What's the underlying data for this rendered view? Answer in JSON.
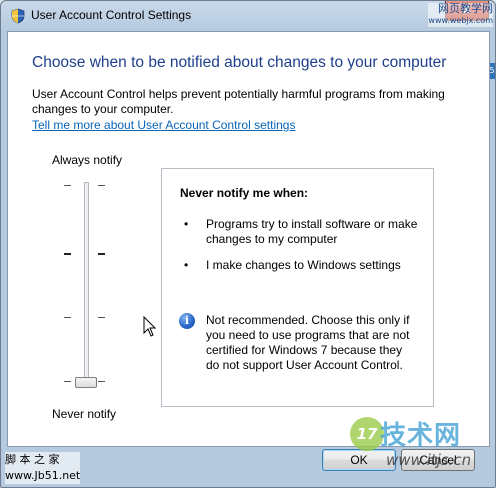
{
  "window": {
    "title": "User Account Control Settings",
    "close_label": "x"
  },
  "watermark_top_right": {
    "line1": "网页教学网",
    "line2": "www.webjx.com"
  },
  "main": {
    "heading": "Choose when to be notified about changes to your computer",
    "description": "User Account Control helps prevent potentially harmful programs from making changes to your computer.",
    "link": "Tell me more about User Account Control settings"
  },
  "slider": {
    "top_label": "Always notify",
    "bottom_label": "Never notify",
    "levels": 4,
    "selected_level": 1
  },
  "info": {
    "title": "Never notify me when:",
    "bullets": [
      "Programs try to install software or make changes to my computer",
      "I make changes to Windows settings"
    ],
    "note": "Not recommended. Choose this only if you need to use programs that are not certified for Windows 7 because they do not support User Account Control."
  },
  "buttons": {
    "ok": "OK",
    "cancel": "Cancel"
  },
  "watermark_bottom_left": {
    "line1": "脚 本 之 家",
    "line2": "www.Jb51.net"
  },
  "watermark_bottom_right": {
    "brand": "技术网",
    "url": "www.itjs.cn",
    "badge": "17"
  },
  "side_badge": "5",
  "colors": {
    "heading": "#1e3f8b",
    "link": "#0a64b8",
    "title_bar": "#c9d9ea",
    "close": "#c9483a"
  },
  "icons": {
    "title": "uac-shield-icon",
    "close": "close-icon",
    "info": "info-icon",
    "cursor": "mouse-cursor-icon"
  }
}
